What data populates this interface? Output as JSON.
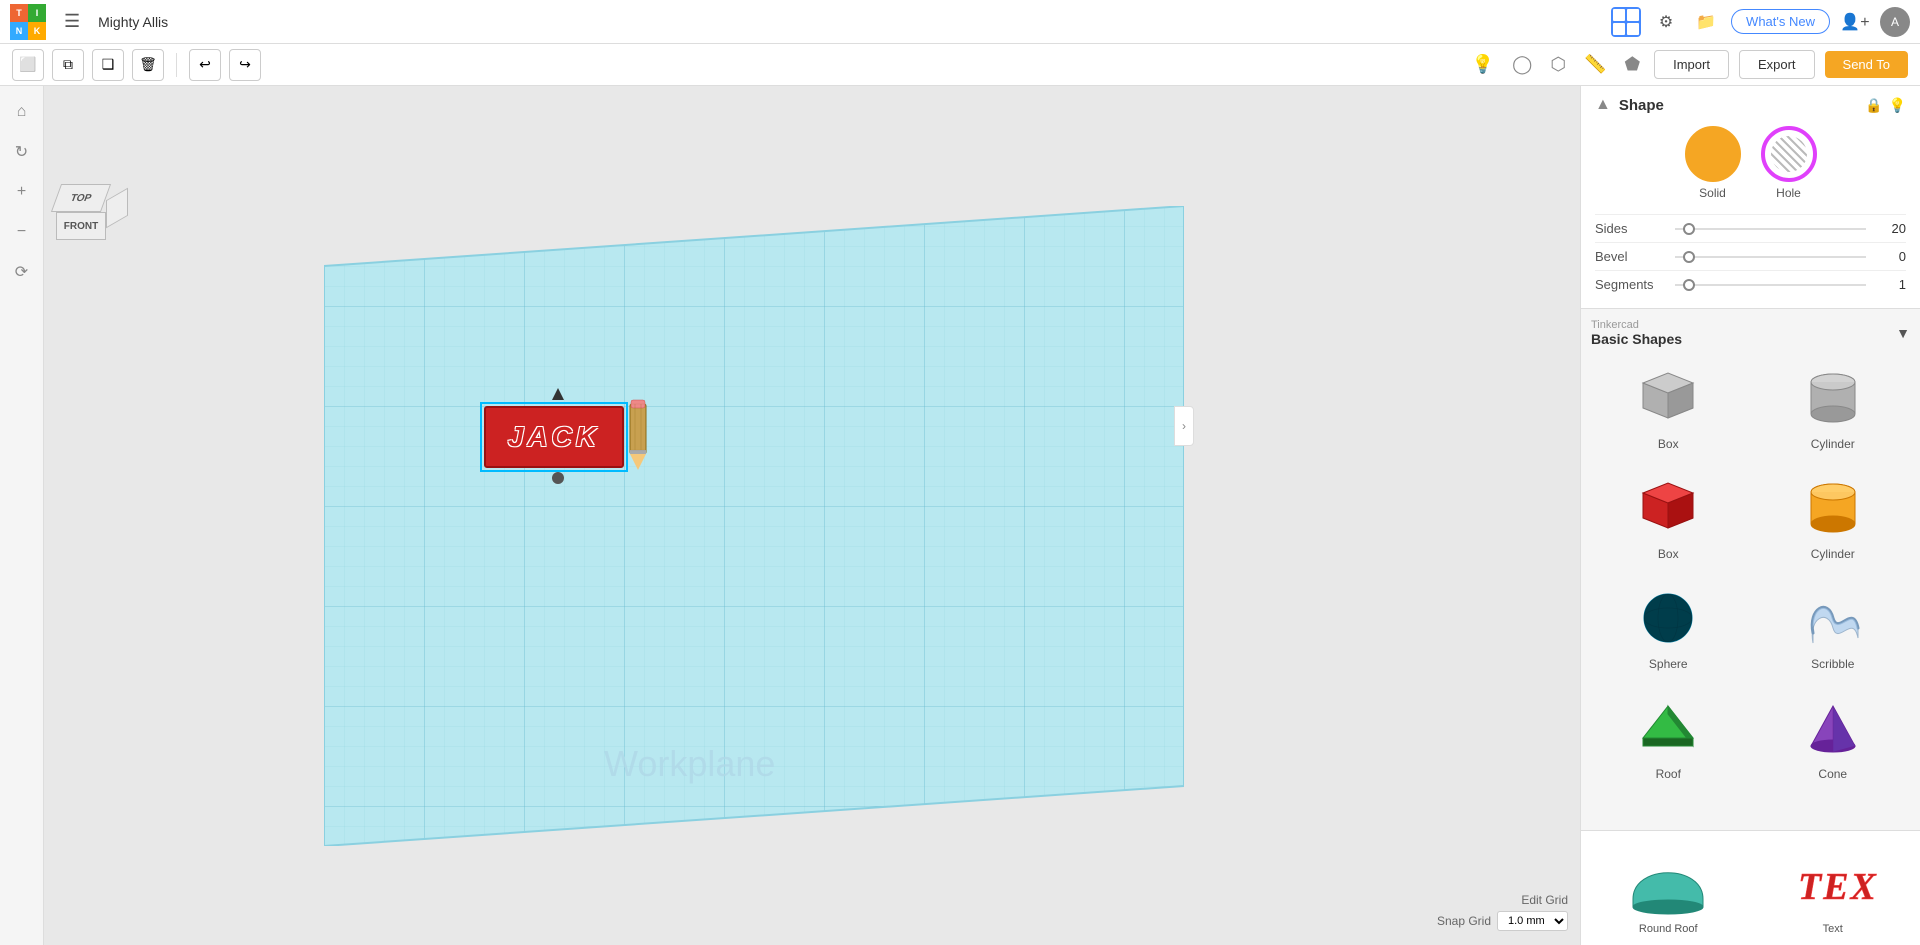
{
  "app": {
    "logo_cells": [
      "T",
      "I",
      "N",
      "K"
    ],
    "title": "Mighty Allis",
    "whats_new": "What's New"
  },
  "toolbar2": {
    "import": "Import",
    "export": "Export",
    "send_to": "Send To"
  },
  "view_cube": {
    "top": "TOP",
    "front": "FRONT"
  },
  "workplane_label": "Workplane",
  "shape_panel": {
    "title": "Shape",
    "solid_label": "Solid",
    "hole_label": "Hole",
    "sides_label": "Sides",
    "sides_value": "20",
    "bevel_label": "Bevel",
    "bevel_value": "0",
    "segments_label": "Segments",
    "segments_value": "1"
  },
  "library": {
    "brand": "Tinkercad",
    "title": "Basic Shapes",
    "shapes": [
      {
        "name": "Box",
        "color": "#bbb",
        "type": "box-grey"
      },
      {
        "name": "Cylinder",
        "color": "#bbb",
        "type": "cylinder-grey"
      },
      {
        "name": "Box",
        "color": "#cc2222",
        "type": "box-red"
      },
      {
        "name": "Cylinder",
        "color": "#f5a623",
        "type": "cylinder-orange"
      },
      {
        "name": "Sphere",
        "color": "#00aacc",
        "type": "sphere-teal"
      },
      {
        "name": "Scribble",
        "color": "#aaccee",
        "type": "scribble"
      },
      {
        "name": "Roof",
        "color": "#22aa44",
        "type": "roof-green"
      },
      {
        "name": "Cone",
        "color": "#8844bb",
        "type": "cone-purple"
      },
      {
        "name": "Round Roof",
        "color": "#44bbaa",
        "type": "round-roof"
      },
      {
        "name": "Text",
        "color": "#cc2222",
        "type": "text-red"
      }
    ]
  },
  "grid_controls": {
    "edit_grid": "Edit Grid",
    "snap_grid": "Snap Grid",
    "snap_value": "1.0 mm"
  }
}
